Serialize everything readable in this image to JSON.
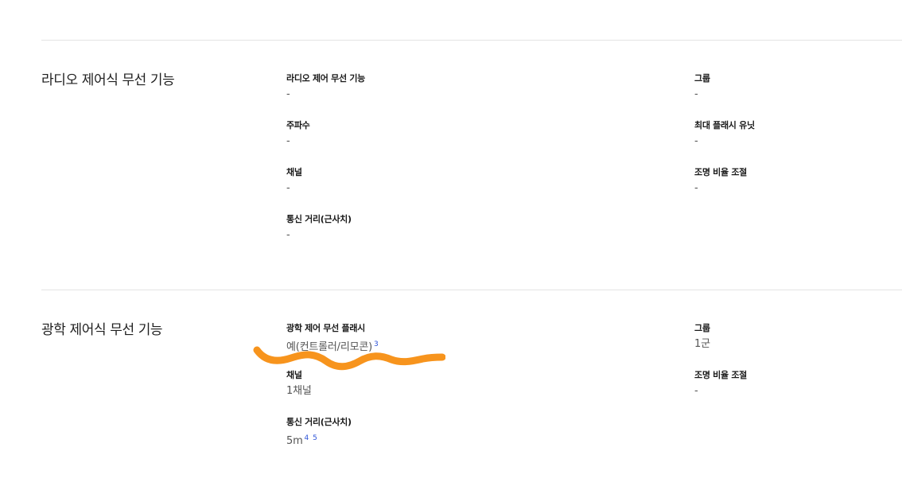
{
  "sections": [
    {
      "title": "라디오 제어식 무선 기능",
      "specs": [
        {
          "label": "라디오 제어 무선 기능",
          "value": "-"
        },
        {
          "label": "그룹",
          "value": "-"
        },
        {
          "label": "주파수",
          "value": "-"
        },
        {
          "label": "최대 플래시 유닛",
          "value": "-"
        },
        {
          "label": "채널",
          "value": "-"
        },
        {
          "label": "조명 비율 조절",
          "value": "-"
        },
        {
          "label": "통신 거리(근사치)",
          "value": "-"
        }
      ]
    },
    {
      "title": "광학 제어식 무선 기능",
      "specs": [
        {
          "label": "광학 제어 무선 플래시",
          "value": "예(컨트롤러/리모콘)",
          "footnotes": [
            "3"
          ]
        },
        {
          "label": "그룹",
          "value": "1군"
        },
        {
          "label": "채널",
          "value": "1채널"
        },
        {
          "label": "조명 비율 조절",
          "value": "-"
        },
        {
          "label": "통신 거리(근사치)",
          "value": "5m",
          "footnotes": [
            "4",
            "5"
          ]
        }
      ]
    }
  ],
  "colors": {
    "divider": "#e4e4e4",
    "footnote_link": "#2d54d8",
    "annotation_squiggle": "#f7941d"
  }
}
